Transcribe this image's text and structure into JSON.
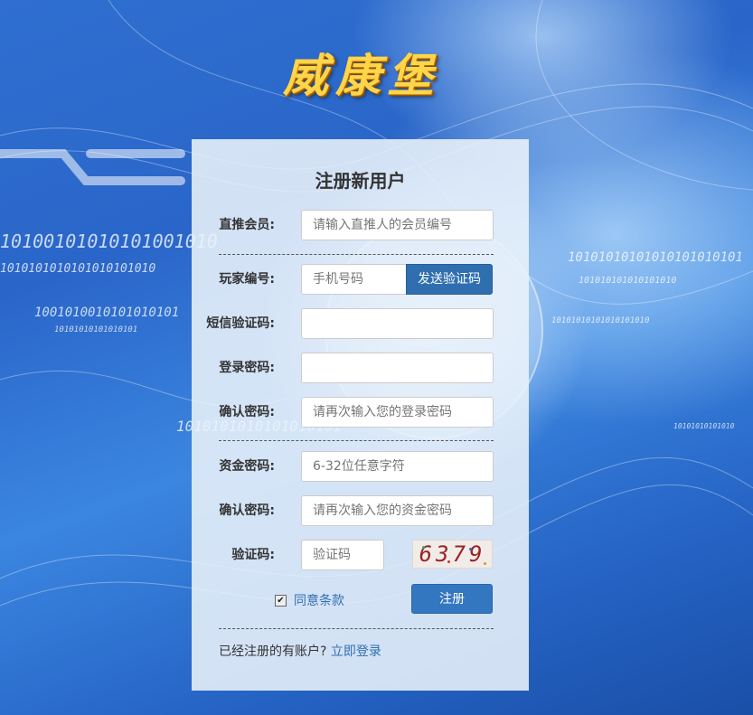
{
  "logo": {
    "text": "威康堡"
  },
  "form": {
    "title": "注册新用户",
    "fields": [
      {
        "label": "直推会员:",
        "placeholder": "请输入直推人的会员编号"
      },
      {
        "label": "玩家编号:",
        "placeholder": "手机号码"
      },
      {
        "label": "短信验证码:",
        "placeholder": ""
      },
      {
        "label": "登录密码:",
        "placeholder": ""
      },
      {
        "label": "确认密码:",
        "placeholder": "请再次输入您的登录密码"
      },
      {
        "label": "资金密码:",
        "placeholder": "6-32位任意字符"
      },
      {
        "label": "确认密码:",
        "placeholder": "请再次输入您的资金密码"
      },
      {
        "label": "验证码:",
        "placeholder": "验证码"
      }
    ],
    "send_code_label": "发送验证码",
    "captcha_text": "6379",
    "agree_checked": true,
    "agree_label": "同意条款",
    "register_label": "注册",
    "footer_text": "已经注册的有账户?",
    "login_link": "立即登录"
  },
  "background": {
    "binary_1": "10100101010101001010",
    "binary_2": "1010101010101010101010",
    "binary_3": "1001010010101010101",
    "binary_4": "10101010101010101",
    "binary_5": "1010101010101010101",
    "binary_6": "10101010101010101010101",
    "binary_7": "101010101010101010",
    "binary_8": "10101010101010101010",
    "binary_9": "10101010101010"
  },
  "colors": {
    "accent": "#2f6fb0",
    "logo_gold": "#ffd54a"
  }
}
